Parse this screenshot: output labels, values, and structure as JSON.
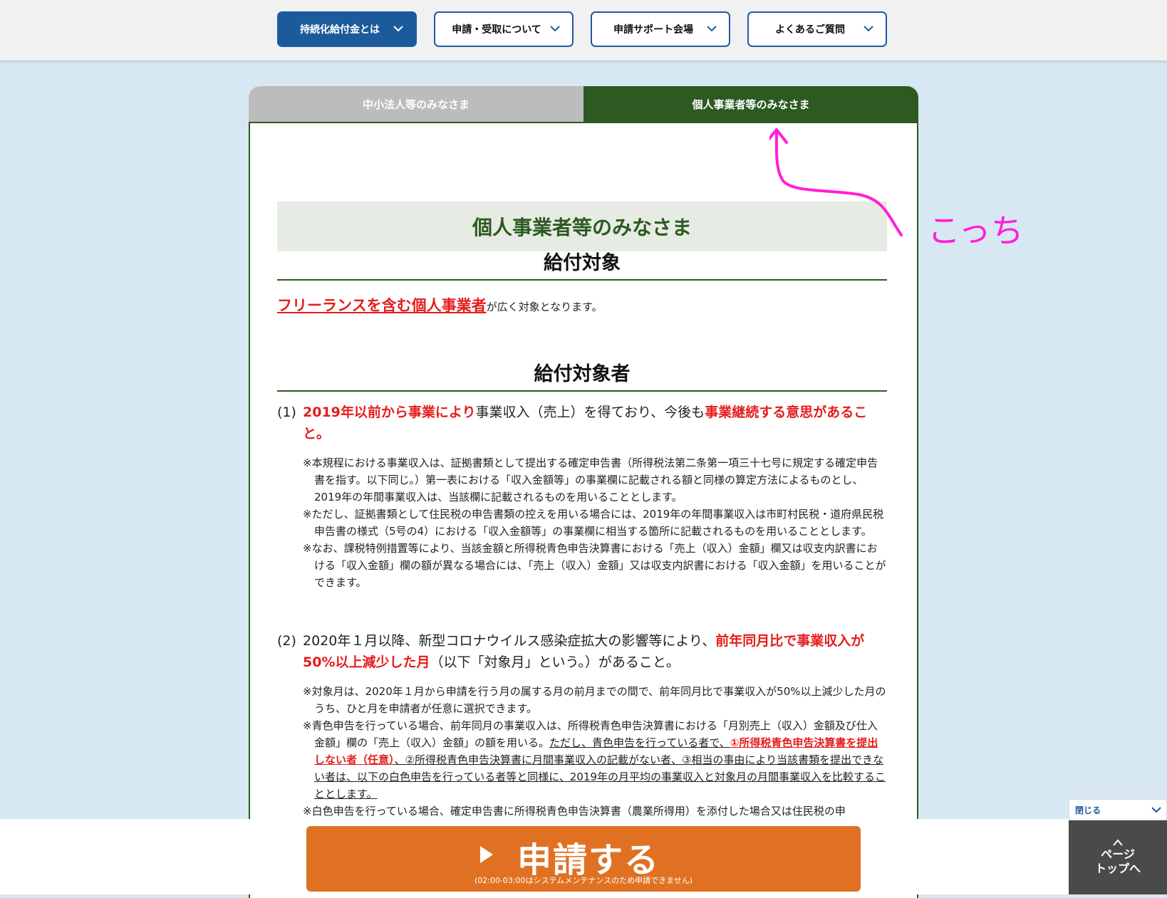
{
  "nav": {
    "items": [
      {
        "label": "持続化給付金とは"
      },
      {
        "label": "申請・受取について"
      },
      {
        "label": "申請サポート会場"
      },
      {
        "label": "よくあるご質問"
      }
    ]
  },
  "tabs": {
    "left": "中小法人等のみなさま",
    "right": "個人事業者等のみなさま"
  },
  "content": {
    "title": "個人事業者等のみなさま",
    "section1_heading": "給付対象",
    "intro_red": "フリーランスを含む個人事業者",
    "intro_rest": "が広く対象となります。",
    "section2_heading": "給付対象者",
    "item1": {
      "num": "(1)",
      "red1": "2019年以前から事業により",
      "mid": "事業収入（売上）を得ており、今後も",
      "red2": "事業継続する意思があること。",
      "notes": [
        "※本規程における事業収入は、証拠書類として提出する確定申告書（所得税法第二条第一項三十七号に規定する確定申告書を指す。以下同じ。）第一表における「収入金額等」の事業欄に記載される額と同様の算定方法によるものとし、2019年の年間事業収入は、当該欄に記載されるものを用いることとします。",
        "※ただし、証拠書類として住民税の申告書類の控えを用いる場合には、2019年の年間事業収入は市町村民税・道府県民税申告書の様式（5号の4）における「収入金額等」の事業欄に相当する箇所に記載されるものを用いることとします。",
        "※なお、課税特例措置等により、当該金額と所得税青色申告決算書における「売上（収入）金額」欄又は収支内訳書における「収入金額」欄の額が異なる場合には、「売上（収入）金額」又は収支内訳書における「収入金額」を用いることができます。"
      ]
    },
    "item2": {
      "num": "(2)",
      "pre": "2020年１月以降、新型コロナウイルス感染症拡大の影響等により、",
      "red": "前年同月比で事業収入が50%以上減少した月",
      "post": "（以下「対象月」という。）があること。",
      "note1": "※対象月は、2020年１月から申請を行う月の属する月の前月までの間で、前年同月比で事業収入が50%以上減少した月のうち、ひと月を申請者が任意に選択できます。",
      "note2_a": "※青色申告を行っている場合、前年同月の事業収入は、所得税青色申告決算書における「月別売上（収入）金額及び仕入金額」欄の「売上（収入）金額」の額を用いる。",
      "note2_u1": "ただし、青色申告を行っている者で、",
      "note2_red": "①所得税青色申告決算書を提出しない者（任意）",
      "note2_u2": "、②所得税青色申告決算書に月間事業収入の記載がない者、③相当の事由により当該書類を提出できない者は、以下の白色申告を行っている者等と同様に、2019年の月平均の事業収入と対象月の月間事業収入を比較することとします。",
      "note3": "※白色申告を行っている場合、確定申告書に所得税青色申告決算書（農業所得用）を添付した場合又は住民税の申"
    }
  },
  "apply": {
    "label": "申請する",
    "sub": "(02:00-03:00はシステムメンテナンスのため申請できません)"
  },
  "close": {
    "label": "閉じる"
  },
  "pagetop": {
    "line1": "ページ",
    "line2": "トップへ"
  },
  "annotation": {
    "text": "こっち",
    "color": "#ff1fd8"
  },
  "colors": {
    "nav_blue": "#1c5b9b",
    "tab_green": "#2c5a21",
    "accent_red": "#e51d1d",
    "apply_orange": "#e07123"
  }
}
